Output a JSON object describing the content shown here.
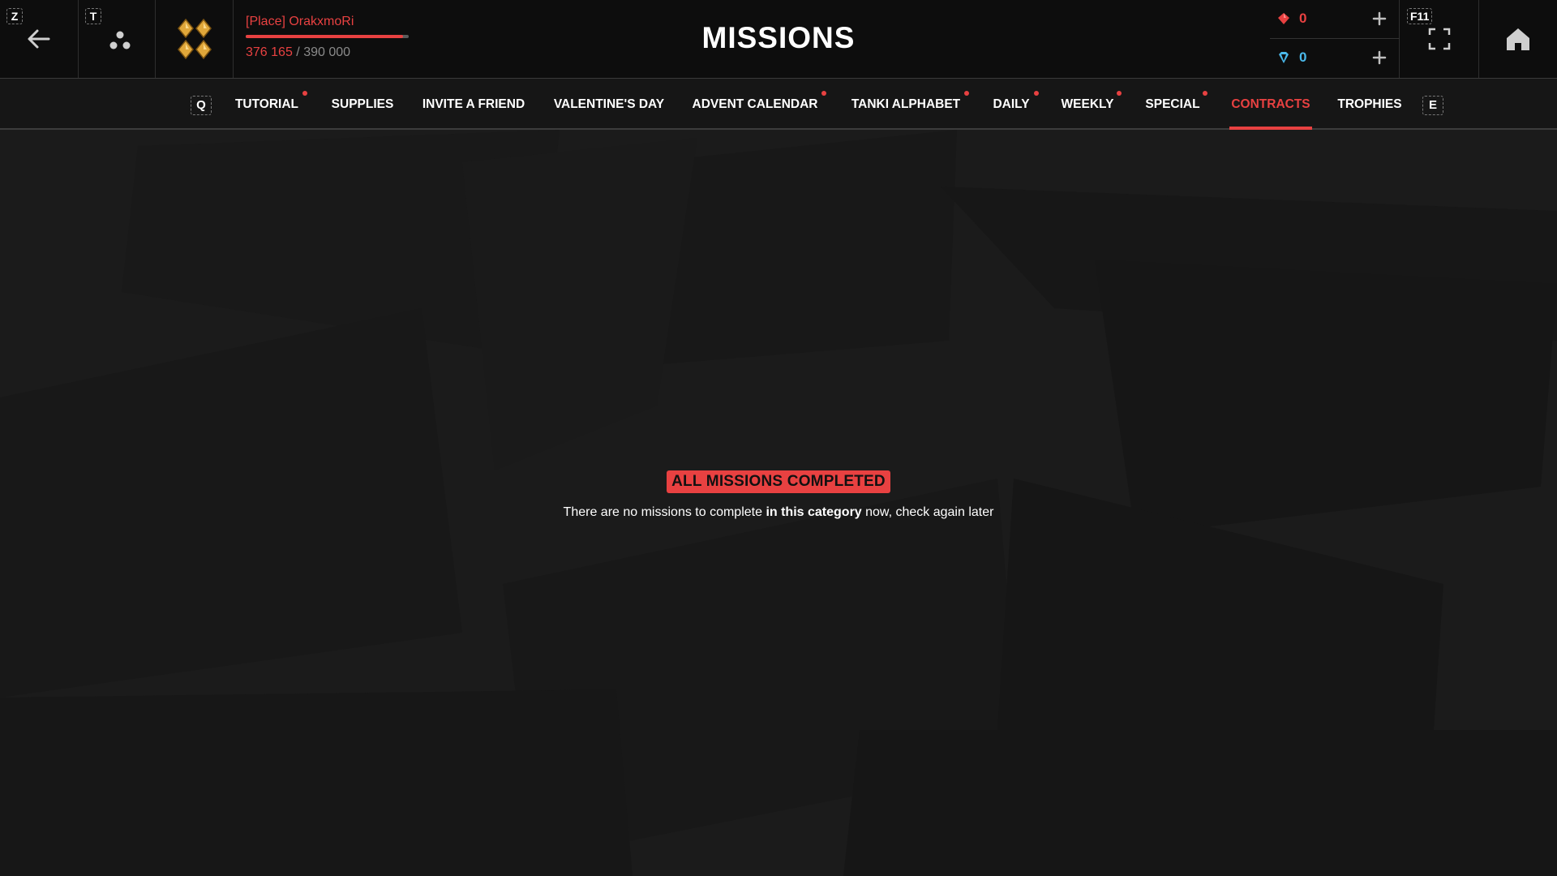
{
  "header": {
    "title": "MISSIONS",
    "back_key": "Z",
    "social_key": "T",
    "fullscreen_key": "F11"
  },
  "profile": {
    "name": "[Place] OrakxmoRi",
    "exp_current": "376 165",
    "exp_separator": "/",
    "exp_max": "390 000",
    "exp_progress": 0.9645
  },
  "currencies": {
    "crystals": {
      "value": "0",
      "icon": "crystal-icon",
      "color": "#e84141"
    },
    "premium": {
      "value": "0",
      "icon": "diamond-icon",
      "color": "#4ab8ea"
    }
  },
  "tabs": {
    "prev_key": "Q",
    "next_key": "E",
    "items": [
      {
        "label": "TUTORIAL",
        "notification": true,
        "active": false
      },
      {
        "label": "SUPPLIES",
        "notification": false,
        "active": false
      },
      {
        "label": "INVITE A FRIEND",
        "notification": false,
        "active": false
      },
      {
        "label": "VALENTINE'S DAY",
        "notification": false,
        "active": false
      },
      {
        "label": "ADVENT CALENDAR",
        "notification": true,
        "active": false
      },
      {
        "label": "TANKI ALPHABET",
        "notification": true,
        "active": false
      },
      {
        "label": "DAILY",
        "notification": true,
        "active": false
      },
      {
        "label": "WEEKLY",
        "notification": true,
        "active": false
      },
      {
        "label": "SPECIAL",
        "notification": true,
        "active": false
      },
      {
        "label": "CONTRACTS",
        "notification": false,
        "active": true
      },
      {
        "label": "TROPHIES",
        "notification": false,
        "active": false
      }
    ]
  },
  "empty_state": {
    "badge": "ALL MISSIONS COMPLETED",
    "message_prefix": "There are no missions to complete ",
    "message_bold": "in this category",
    "message_suffix": " now, check again later"
  },
  "colors": {
    "accent": "#e84141",
    "premium": "#4ab8ea",
    "rank_gold": "#e0a73a"
  }
}
